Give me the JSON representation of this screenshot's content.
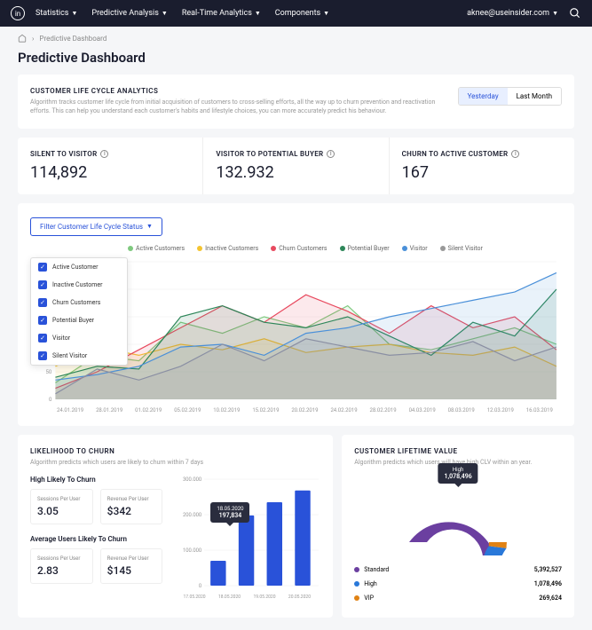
{
  "nav": {
    "items": [
      "Statistics",
      "Predictive Analysis",
      "Real-Time Analytics",
      "Components"
    ],
    "user": "aknee@useinsider.com"
  },
  "breadcrumb": "Predictive Dashboard",
  "page_title": "Predictive Dashboard",
  "lifecycle": {
    "title": "CUSTOMER LIFE CYCLE ANALYTICS",
    "desc": "Algorithm tracks customer life cycle from initial acquisition of customers to cross-selling efforts, all the way up to churn prevention and reactivation efforts. This can help you understand each customer's habits and lifestyle choices, you can more accurately predict his behaviour.",
    "toggle": {
      "yesterday": "Yesterday",
      "last_month": "Last Month"
    }
  },
  "metrics": [
    {
      "label": "SILENT TO VISITOR",
      "value": "114,892"
    },
    {
      "label": "VISITOR TO POTENTIAL BUYER",
      "value": "132.932"
    },
    {
      "label": "CHURN TO ACTIVE CUSTOMER",
      "value": "167"
    }
  ],
  "filter_btn": "Filter Customer Life Cycle Status",
  "filter_options": [
    "Active Customer",
    "Inactive Customer",
    "Churn Customers",
    "Potential Buyer",
    "Visitor",
    "Silent Visitor"
  ],
  "legend": [
    {
      "label": "Active Customers",
      "color": "#7fc97f"
    },
    {
      "label": "Inactive Customers",
      "color": "#f4c430"
    },
    {
      "label": "Churn Customers",
      "color": "#e84a5f"
    },
    {
      "label": "Potential Buyer",
      "color": "#2d8659"
    },
    {
      "label": "Visitor",
      "color": "#4a90d9"
    },
    {
      "label": "Silent Visitor",
      "color": "#999"
    }
  ],
  "chart_data": {
    "type": "line",
    "ylim": [
      0,
      250
    ],
    "yticks": [
      0,
      50,
      100,
      150,
      200,
      250
    ],
    "categories": [
      "24.01.2019",
      "28.01.2019",
      "01.02.2019",
      "05.02.2019",
      "10.02.2019",
      "15.02.2019",
      "20.02.2019",
      "24.02.2019",
      "28.02.2019",
      "04.03.2019",
      "08.03.2019",
      "12.03.2019",
      "16.03.2019"
    ],
    "series": [
      {
        "name": "Active Customers",
        "color": "#7fc97f",
        "values": [
          30,
          80,
          70,
          140,
          120,
          150,
          130,
          170,
          100,
          90,
          110,
          130,
          100
        ]
      },
      {
        "name": "Inactive Customers",
        "color": "#f4c430",
        "values": [
          60,
          95,
          80,
          100,
          90,
          110,
          85,
          95,
          100,
          85,
          80,
          95,
          60
        ]
      },
      {
        "name": "Churn Customers",
        "color": "#e84a5f",
        "values": [
          20,
          50,
          90,
          130,
          170,
          140,
          190,
          160,
          120,
          170,
          130,
          150,
          90
        ]
      },
      {
        "name": "Potential Buyer",
        "color": "#2d8659",
        "values": [
          40,
          60,
          55,
          150,
          170,
          140,
          130,
          150,
          115,
          80,
          140,
          115,
          200
        ]
      },
      {
        "name": "Visitor",
        "color": "#4a90d9",
        "values": [
          35,
          45,
          60,
          95,
          100,
          80,
          120,
          130,
          150,
          165,
          180,
          195,
          230
        ]
      },
      {
        "name": "Silent Visitor",
        "color": "#8a8fa3",
        "values": [
          10,
          55,
          35,
          60,
          100,
          70,
          110,
          95,
          80,
          85,
          105,
          70,
          95
        ]
      }
    ]
  },
  "churn": {
    "title": "LIKELIHOOD TO CHURN",
    "desc": "Algorithm predicts which users are likely to churn within 7 days",
    "high_title": "High Likely To Churn",
    "avg_title": "Average Users Likely To Churn",
    "sessions_label": "Sessions Per User",
    "revenue_label": "Revenue Per User",
    "high_sessions": "3.05",
    "high_revenue": "$342",
    "avg_sessions": "2.83",
    "avg_revenue": "$145",
    "bar_data": {
      "type": "bar",
      "ylim": [
        0,
        300000
      ],
      "yticks": [
        "0",
        "100.000",
        "200.000",
        "300.000"
      ],
      "categories": [
        "17.05.2020",
        "18.05.2020",
        "19.05.2020",
        "20.05.2020"
      ],
      "values": [
        70000,
        197834,
        235000,
        268000
      ],
      "tooltip": {
        "date": "18.05.2020",
        "value": "197,834"
      }
    }
  },
  "clv": {
    "title": "CUSTOMER LIFETIME VALUE",
    "desc": "Algorithm predicts which users will have high CLV within an year.",
    "tooltip": {
      "label": "High",
      "value": "1,078,496"
    },
    "donut": {
      "type": "pie",
      "series": [
        {
          "name": "Standard",
          "color": "#6b3fa0",
          "value": 5392527
        },
        {
          "name": "High",
          "color": "#2978d9",
          "value": 1078496
        },
        {
          "name": "VIP",
          "color": "#e08214",
          "value": 269624
        }
      ]
    },
    "rows": [
      {
        "label": "Standard",
        "color": "#6b3fa0",
        "value": "5,392,527"
      },
      {
        "label": "High",
        "color": "#2978d9",
        "value": "1,078,496"
      },
      {
        "label": "VIP",
        "color": "#e08214",
        "value": "269,624"
      }
    ]
  }
}
